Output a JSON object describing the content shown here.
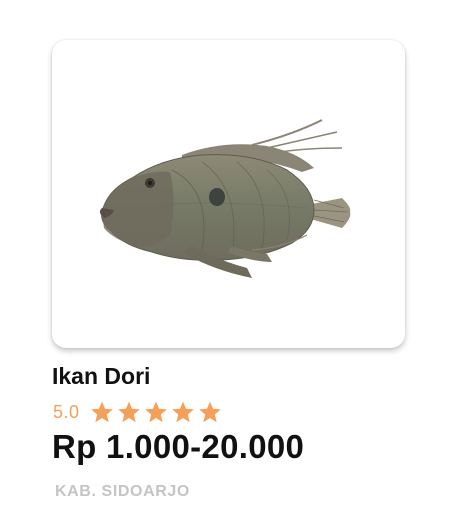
{
  "product": {
    "name": "Ikan Dori",
    "rating": "5.0",
    "stars_filled": 5,
    "stars_total": 5,
    "price": "Rp 1.000-20.000",
    "location": "KAB. SIDOARJO",
    "image_icon": "fish-image"
  },
  "colors": {
    "star": "#f5a05a",
    "rating_text": "#f5a05a",
    "location_text": "#c4c4c4",
    "title_text": "#111111"
  }
}
